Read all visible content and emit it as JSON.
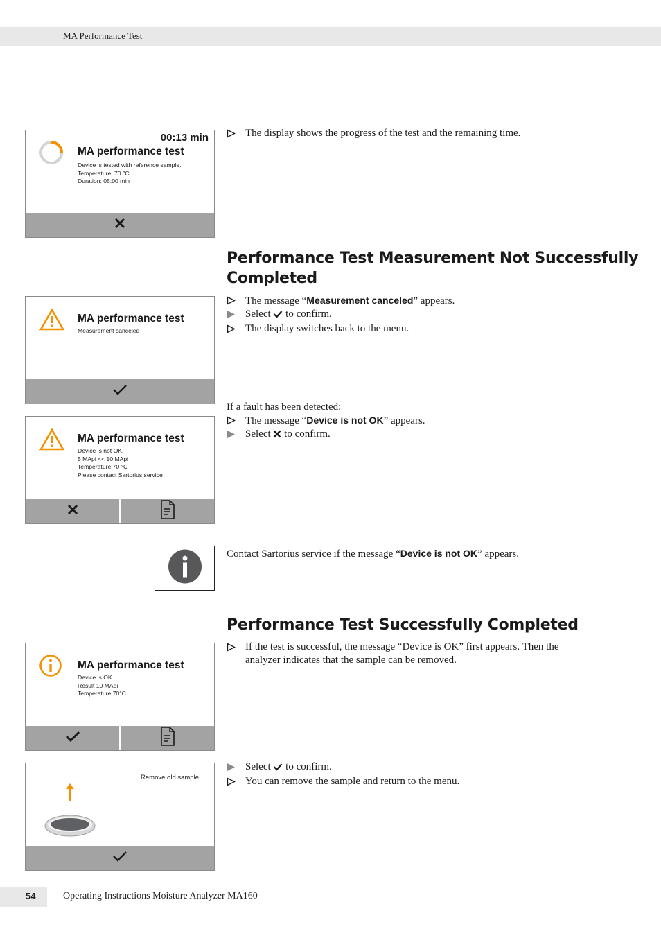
{
  "header": {
    "title": "MA Performance Test"
  },
  "colors": {
    "accent_orange": "#f39200",
    "button_bar": "#a3a3a3",
    "band_gray": "#e8e8e8",
    "info_gray": "#58585a"
  },
  "screen_progress": {
    "time": "00:13 min",
    "title": "MA performance test",
    "lines": [
      "Device is tested with reference sample.",
      "Temperature: 70 °C",
      "Duration: 05:00 min"
    ],
    "progress_fraction": 0.25,
    "icon": "progress-ring-icon",
    "buttons": [
      {
        "icon": "close-icon"
      }
    ]
  },
  "text_progress": {
    "bullet": "The display shows the progress of the test and the remaining time."
  },
  "section_not_success": {
    "heading_line1": "Performance Test Measurement Not Successfully",
    "heading_line2": "Completed",
    "bullets": [
      {
        "type": "result",
        "pre": "The message “",
        "bold": "Measurement canceled",
        "post": "” appears."
      },
      {
        "type": "action",
        "pre": "Select",
        "icon": "check-icon",
        "post": "to confirm."
      },
      {
        "type": "result",
        "text": "The display switches back to the menu."
      }
    ]
  },
  "screen_canceled": {
    "title": "MA performance test",
    "lines": [
      "Measurement canceled"
    ],
    "icon": "warning-icon",
    "buttons": [
      {
        "icon": "check-icon"
      }
    ]
  },
  "fault": {
    "intro": "If a fault has been detected:",
    "bullets": [
      {
        "type": "result",
        "pre": "The message “",
        "bold": "Device is not OK",
        "post": "” appears."
      },
      {
        "type": "action",
        "pre": "Select",
        "icon": "close-icon",
        "post": "to confirm."
      }
    ]
  },
  "screen_not_ok": {
    "title": "MA performance test",
    "lines": [
      "Device is not OK.",
      "5 MApi << 10 MApi",
      "Temperature 70 °C",
      "Please contact Sartorius service"
    ],
    "icon": "warning-icon",
    "buttons": [
      {
        "icon": "close-icon"
      },
      {
        "icon": "document-icon"
      }
    ]
  },
  "note": {
    "pre": "Contact Sartorius service if the message “",
    "bold": "Device is not OK",
    "post": "” appears.",
    "icon": "info-icon"
  },
  "section_success": {
    "heading": "Performance Test Successfully Completed",
    "bullet_line1": "If the test is successful, the message “Device is OK” first appears. Then the",
    "bullet_line2": "analyzer indicates that the sample can be removed.",
    "bullets2": [
      {
        "type": "action",
        "pre": "Select",
        "icon": "check-icon",
        "post": "to confirm."
      },
      {
        "type": "result",
        "text": "You can remove the sample and return to the menu."
      }
    ]
  },
  "screen_ok": {
    "title": "MA performance test",
    "lines": [
      "Device is OK.",
      "Result 10 MApi",
      "Temperature 70°C"
    ],
    "icon": "info-circle-icon",
    "buttons": [
      {
        "icon": "check-icon"
      },
      {
        "icon": "document-icon"
      }
    ]
  },
  "screen_remove": {
    "message": "Remove old sample",
    "icon": "sample-pan-icon",
    "buttons": [
      {
        "icon": "check-icon"
      }
    ]
  },
  "footer": {
    "page_number": "54",
    "text": "Operating Instructions Moisture Analyzer MA160"
  }
}
